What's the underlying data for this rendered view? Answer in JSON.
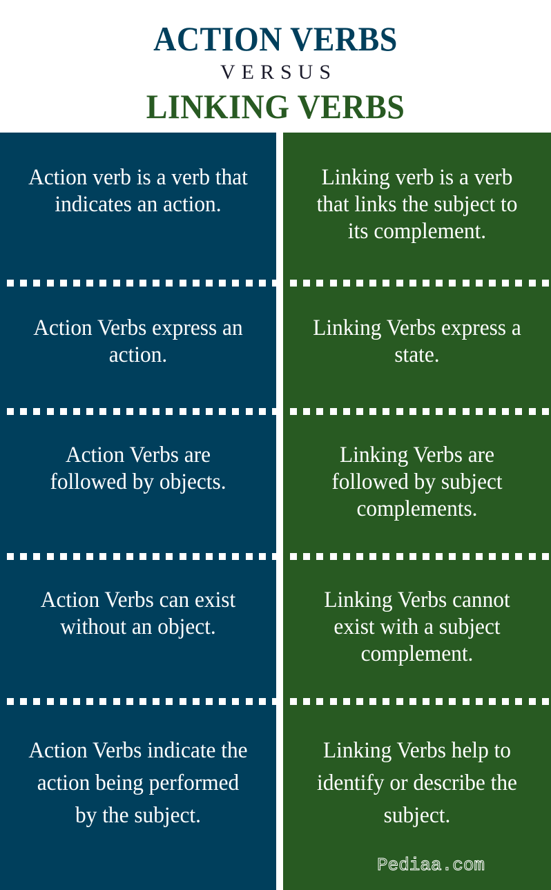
{
  "header": {
    "title_top": "ACTION VERBS",
    "versus": "VERSUS",
    "title_bottom": "LINKING VERBS"
  },
  "colors": {
    "action": "#003f5c",
    "linking": "#285a22",
    "background": "#ffffff",
    "text_on_panel": "#ffffff"
  },
  "comparison": {
    "action_verbs": [
      "Action verb is a verb that indicates an action.",
      "Action Verbs express an action.",
      "Action Verbs are followed by objects.",
      "Action Verbs can exist without an object.",
      "Action Verbs indicate the action being performed by the subject."
    ],
    "linking_verbs": [
      "Linking verb is a verb that links the subject to its complement.",
      "Linking Verbs express a state.",
      "Linking Verbs are followed by subject complements.",
      "Linking Verbs cannot exist with a subject complement.",
      "Linking Verbs help to identify or describe the subject."
    ]
  },
  "watermark": "Pediaa.com"
}
